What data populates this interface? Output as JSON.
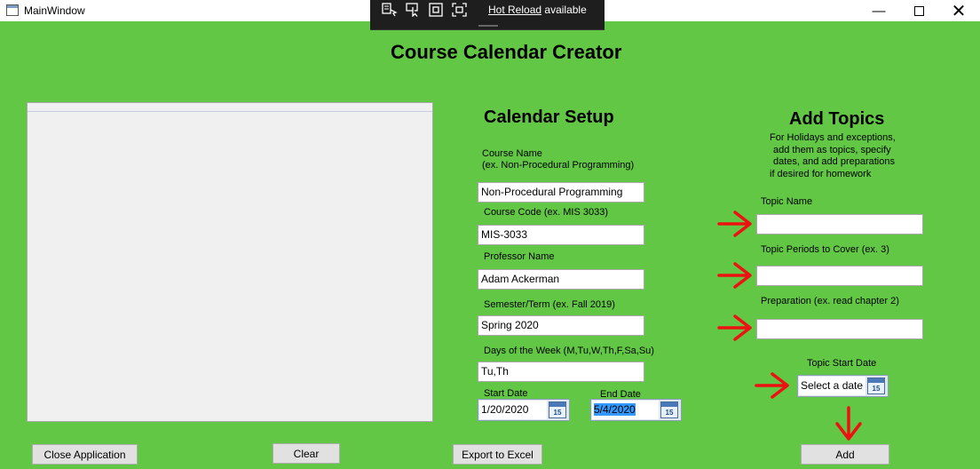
{
  "window": {
    "title": "MainWindow",
    "minimize_glyph": "—",
    "close_glyph": "✕"
  },
  "hot_reload": {
    "link": "Hot Reload",
    "text": "available"
  },
  "app": {
    "title": "Course Calendar Creator"
  },
  "calendar_setup": {
    "title": "Calendar Setup",
    "course_name_label_1": "Course Name",
    "course_name_label_2": "(ex. Non-Procedural Programming)",
    "course_name_value": "Non-Procedural Programming",
    "course_code_label": "Course Code (ex. MIS 3033)",
    "course_code_value": "MIS-3033",
    "professor_label": "Professor Name",
    "professor_value": "Adam Ackerman",
    "semester_label": "Semester/Term (ex. Fall 2019)",
    "semester_value": "Spring 2020",
    "days_label": "Days of the Week (M,Tu,W,Th,F,Sa,Su)",
    "days_value": "Tu,Th",
    "start_date_label": "Start Date",
    "start_date_value": "1/20/2020",
    "end_date_label": "End Date",
    "end_date_value": "5/4/2020",
    "calendar_icon_number": "15"
  },
  "add_topics": {
    "title": "Add Topics",
    "description_lines": [
      "For Holidays and exceptions,",
      "add them as topics, specify",
      "dates, and add preparations",
      "if desired for homework"
    ],
    "topic_name_label": "Topic Name",
    "topic_name_value": "",
    "periods_label": "Topic Periods to Cover (ex. 3)",
    "periods_value": "",
    "preparation_label": "Preparation (ex. read chapter 2)",
    "preparation_value": "",
    "start_date_label": "Topic Start Date",
    "start_date_placeholder": "Select a date"
  },
  "buttons": {
    "close": "Close Application",
    "clear": "Clear",
    "export": "Export to Excel",
    "add": "Add"
  },
  "colors": {
    "background": "#62c744",
    "annotation_arrow": "#ee1111"
  },
  "icons": [
    "app-window-icon",
    "select-element-icon",
    "pointer-icon",
    "layout-adorner-icon",
    "track-focus-icon",
    "calendar-icon",
    "red-arrow-icon"
  ]
}
